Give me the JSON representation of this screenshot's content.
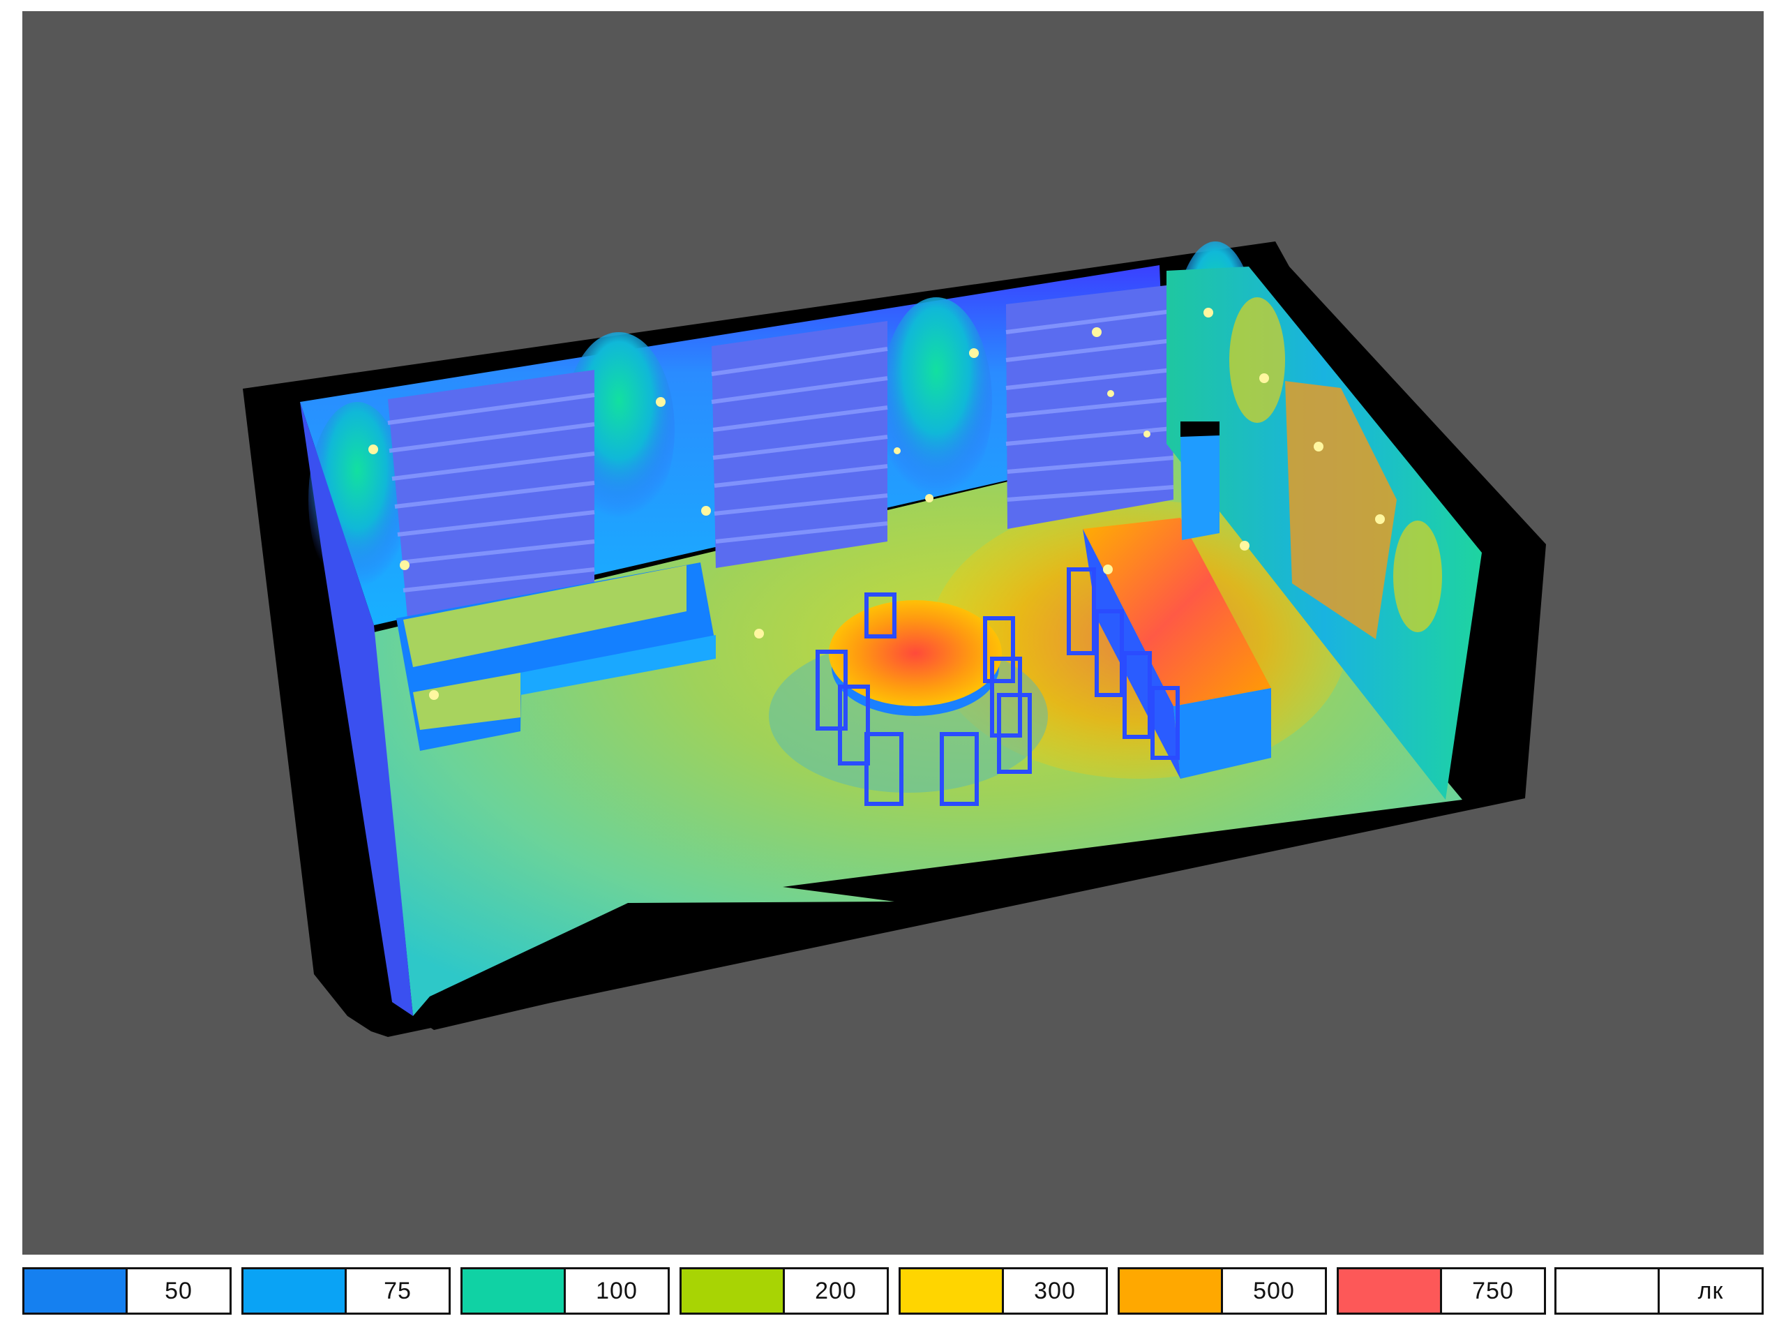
{
  "legend": [
    {
      "label": "50",
      "color": "#1580f0"
    },
    {
      "label": "75",
      "color": "#0aa3f5"
    },
    {
      "label": "100",
      "color": "#10d2a4"
    },
    {
      "label": "200",
      "color": "#a8d404"
    },
    {
      "label": "300",
      "color": "#ffd500"
    },
    {
      "label": "500",
      "color": "#ffa800"
    },
    {
      "label": "750",
      "color": "#fd5858"
    },
    {
      "label": "лк",
      "color": "#ffffff"
    }
  ],
  "colors": {
    "background": "#575757",
    "walls": "#000000",
    "floor_base": "#8fd66e"
  }
}
